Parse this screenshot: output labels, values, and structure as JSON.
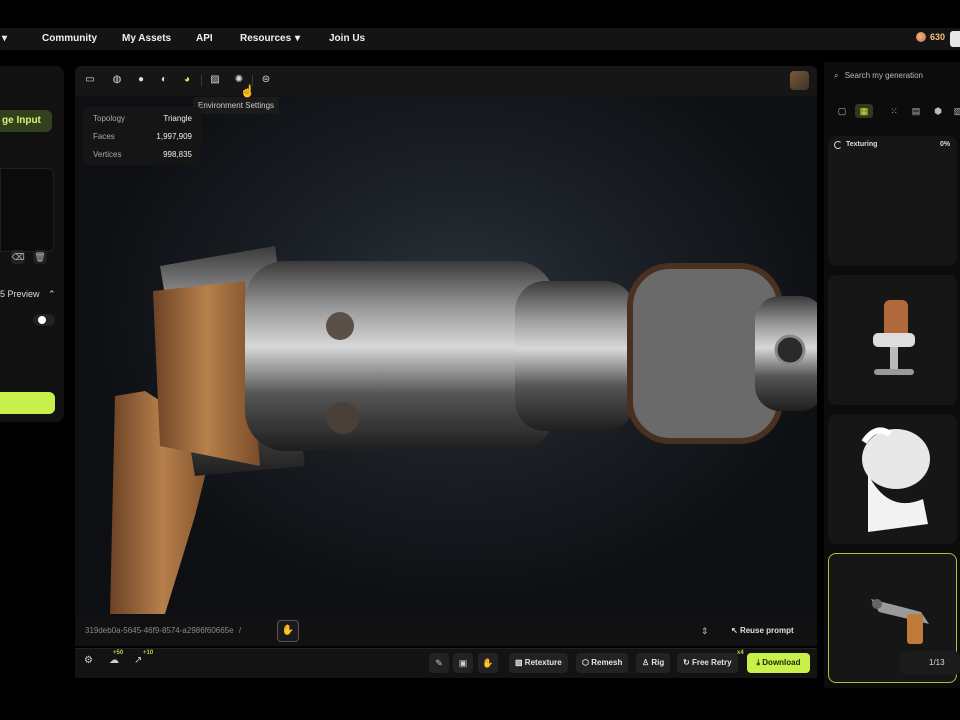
{
  "nav": {
    "items": [
      "Community",
      "My Assets",
      "API",
      "Resources",
      "Join Us"
    ],
    "resources_caret": "▾",
    "credits": "630"
  },
  "left_panel": {
    "image_input_label": "ge Input",
    "preview_label": "5 Preview",
    "preview_caret": "⌃"
  },
  "viewport": {
    "tooltip": "Environment Settings",
    "stats": {
      "topology_label": "Topology",
      "topology_value": "Triangle",
      "faces_label": "Faces",
      "faces_value": "1,997,909",
      "vertices_label": "Vertices",
      "vertices_value": "998,835"
    },
    "uuid": "319deb0a-5645-46f9-8574-a2986f60665e",
    "separator": "/",
    "reuse_prompt": "Reuse prompt"
  },
  "bottom_bar": {
    "like_count": "+50",
    "share_count": "+10",
    "retexture": "Retexture",
    "remesh": "Remesh",
    "rig": "Rig",
    "free_retry": "Free Retry",
    "free_retry_badge": "x4",
    "download": "Download"
  },
  "right_panel": {
    "search_placeholder": "Search my generation",
    "texturing_label": "Texturing",
    "texturing_percent": "0%",
    "page": "1/13"
  },
  "colors": {
    "accent": "#c8f04a",
    "background": "#0c0c0c"
  }
}
